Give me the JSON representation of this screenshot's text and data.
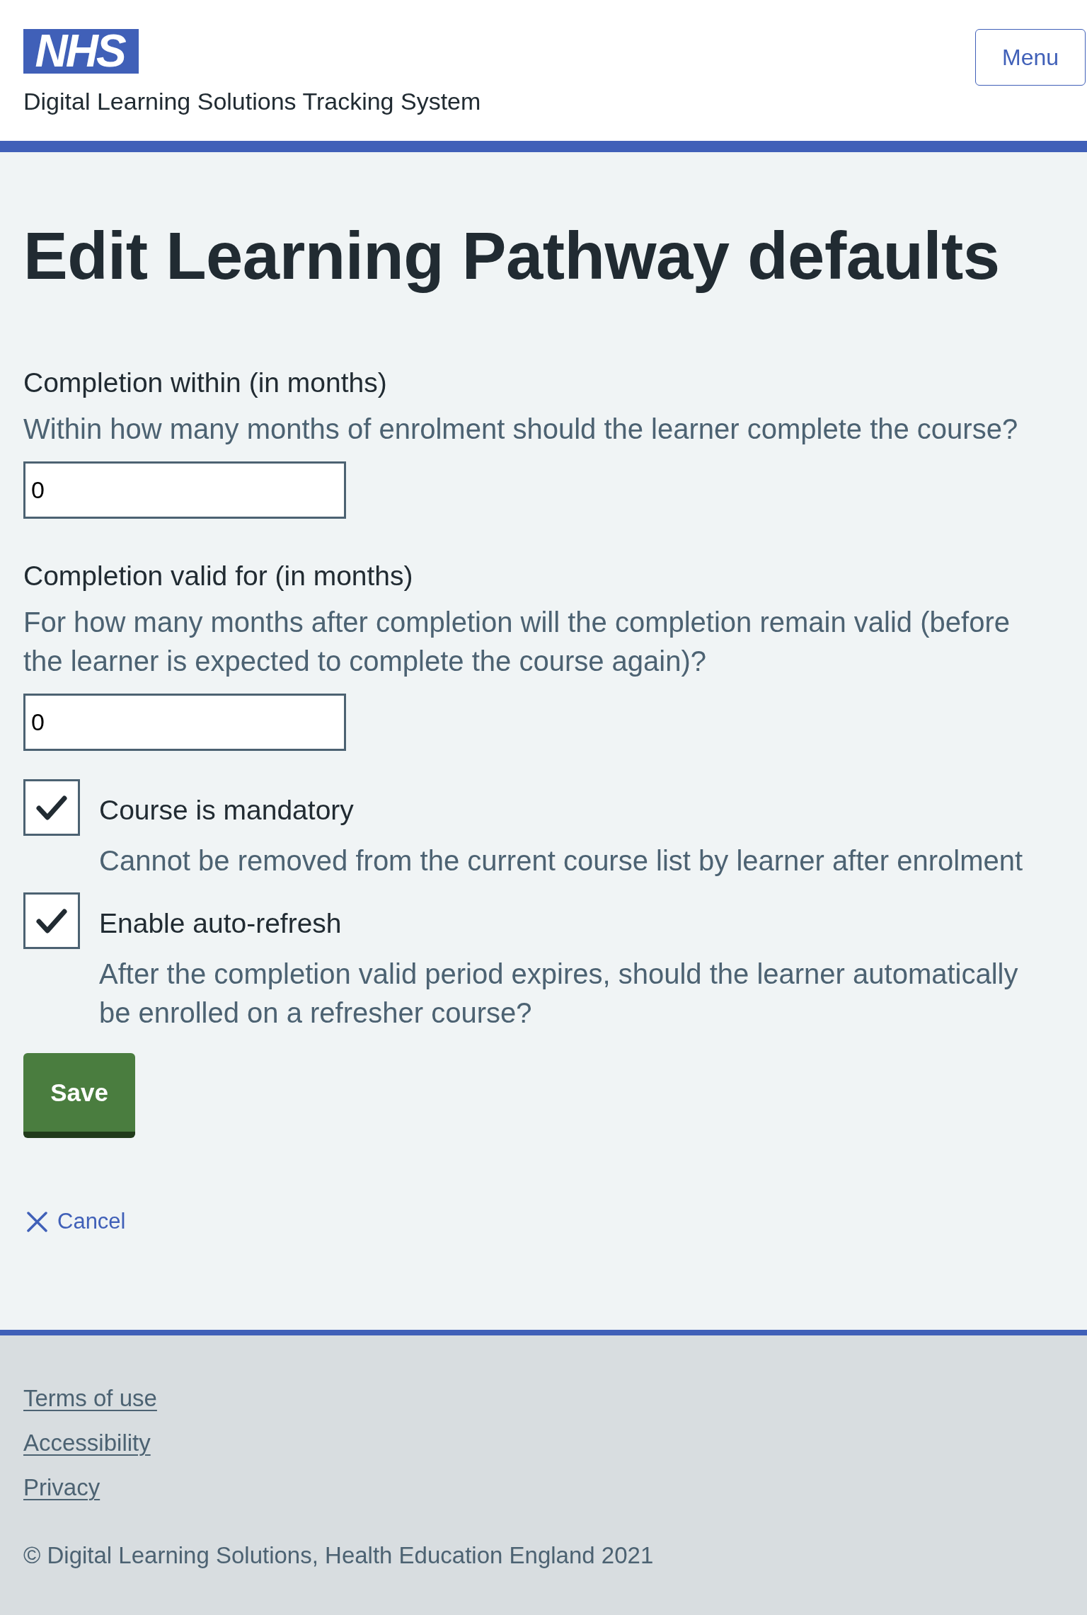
{
  "header": {
    "logo": "NHS",
    "service_name": "Digital Learning Solutions Tracking System",
    "menu_button": "Menu"
  },
  "page_title": "Edit Learning Pathway defaults",
  "fields": [
    {
      "label": "Completion within (in months)",
      "hint": "Within how many months of enrolment should the learner complete the course?",
      "value": "0"
    },
    {
      "label": "Completion valid for (in months)",
      "hint": "For how many months after completion will the completion remain valid (before the learner is expected to complete the course again)?",
      "value": "0"
    }
  ],
  "checkboxes": [
    {
      "label": "Course is mandatory",
      "hint": "Cannot be removed from the current course list by learner after enrolment",
      "checked": true
    },
    {
      "label": "Enable auto-refresh",
      "hint": "After the completion valid period expires, should the learner automatically be enrolled on a refresher course?",
      "checked": true
    }
  ],
  "save_button": "Save",
  "cancel_link": "Cancel",
  "footer": {
    "links": [
      "Terms of use",
      "Accessibility",
      "Privacy"
    ],
    "copyright": "© Digital Learning Solutions, Health Education England 2021"
  }
}
